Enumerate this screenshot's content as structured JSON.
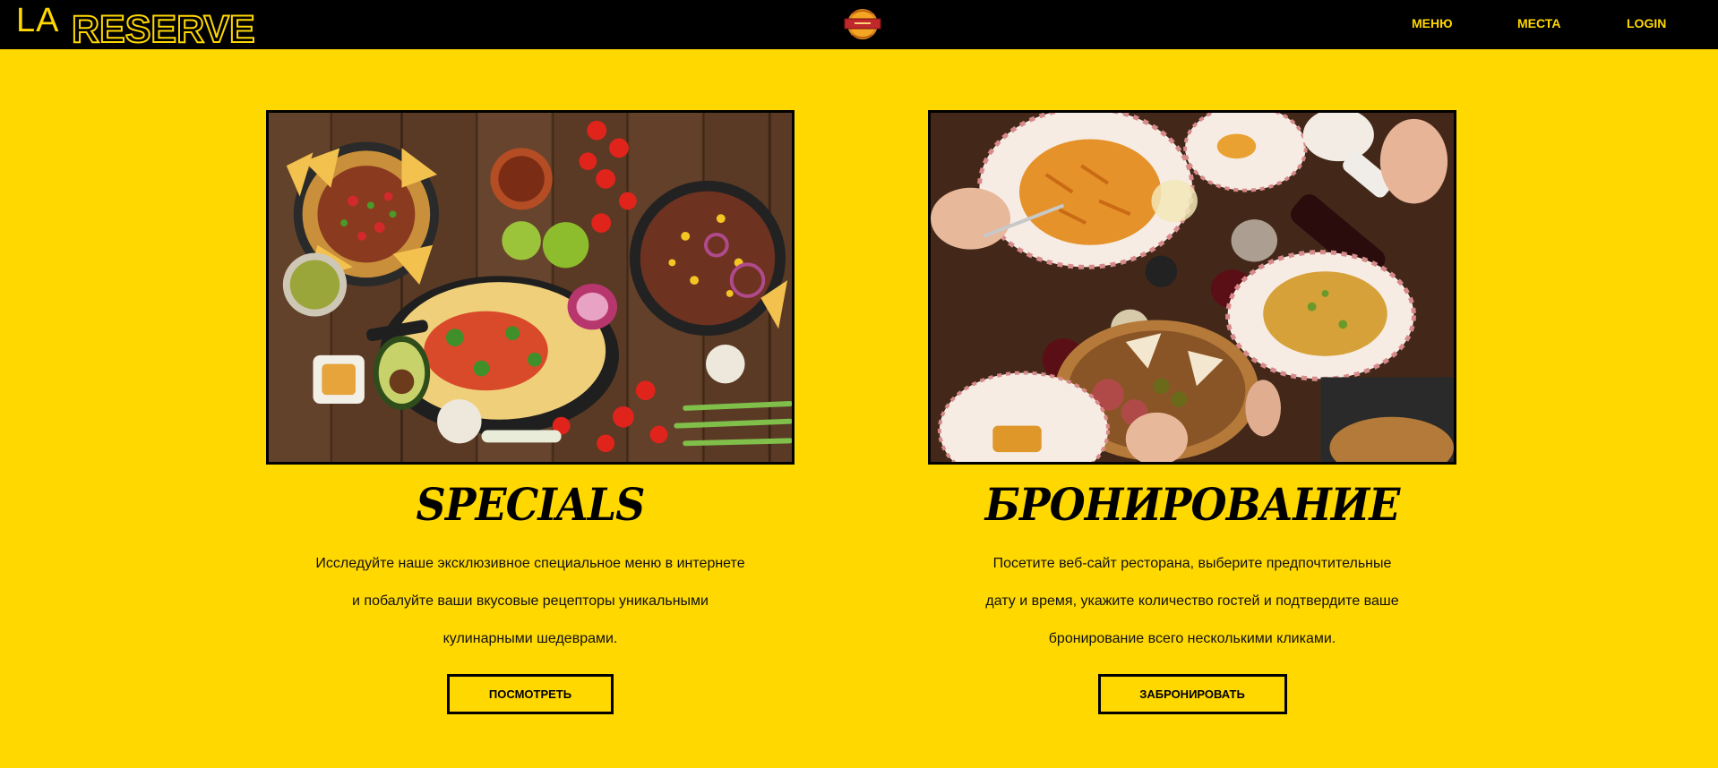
{
  "header": {
    "logo_la": "LA",
    "logo_reserve": "RESERVE",
    "nav": [
      {
        "label": "МЕНЮ"
      },
      {
        "label": "МЕСТА"
      },
      {
        "label": "LOGIN"
      }
    ]
  },
  "cards": [
    {
      "title": "SPECIALS",
      "text_lines": [
        "Исследуйте наше эксклюзивное специальное меню в интернете",
        "и побалуйте ваши вкусовые рецепторы уникальными",
        "кулинарными шедеврами."
      ],
      "button_label": "ПОСМОТРЕТЬ",
      "image": "mexican-food-photo"
    },
    {
      "title": "БРОНИРОВАНИЕ",
      "text_lines": [
        "Посетите веб-сайт ресторана, выберите предпочтительные",
        "дату и время, укажите количество гостей и подтвердите ваше",
        "бронирование всего несколькими кликами."
      ],
      "button_label": "ЗАБРОНИРОВАТЬ",
      "image": "italian-dinner-photo"
    }
  ],
  "colors": {
    "background": "#ffd800",
    "navbar": "#000000",
    "accent": "#ffd800"
  }
}
